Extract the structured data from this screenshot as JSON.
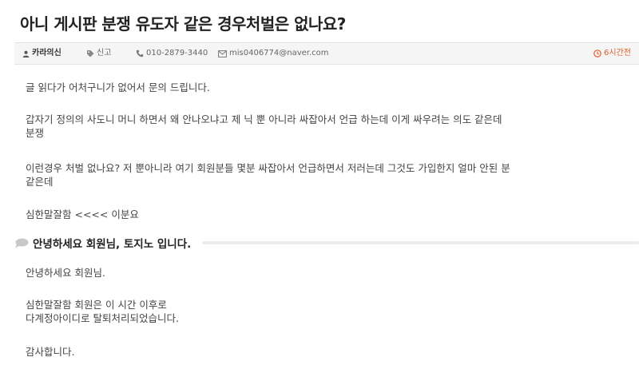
{
  "post": {
    "title": "아니 게시판 분쟁 유도자 같은 경우처벌은 없나요?",
    "meta": {
      "author": "카라의신",
      "report_label": "신고",
      "phone": "010-2879-3440",
      "email": "mis0406774@naver.com",
      "time": "6시간전",
      "icons": {
        "author": "user-icon",
        "report": "tag-icon",
        "phone": "phone-icon",
        "email": "envelope-icon",
        "time": "clock-icon"
      }
    },
    "body": {
      "p1": "글 읽다가 어처구니가 없어서 문의 드립니다.",
      "p2_line1": "갑자기 정의의 사도니 머니 하면서 왜 안나오냐고 제 닉 뿐 아니라 싸잡아서 언급 하는데 이게 싸우려는 의도 같은데",
      "p2_line2": "분쟁",
      "p3_line1": "이런경우 처벌 없나요? 저 뿐아니라 여기 회원분들 몇분 싸잡아서 언급하면서 저러는데 그것도 가입한지 얼마 안된 분",
      "p3_line2": "같은데",
      "p4": "심한말잘함 <<<< 이분요"
    }
  },
  "answer": {
    "title": "안녕하세요 회원님, 토지노 입니다.",
    "icon": "speech-bubble-icon",
    "body": {
      "a1": "안녕하세요 회원님.",
      "a2_line1": "심한말잘함 회원은 이 시간 이후로",
      "a2_line2": "다계정아이디로 탈퇴처리되었습니다.",
      "a3": "감사합니다."
    }
  },
  "colors": {
    "accent_time": "#e25d2b",
    "meta_bar_bg": "#f5f5f5",
    "text": "#444444"
  }
}
